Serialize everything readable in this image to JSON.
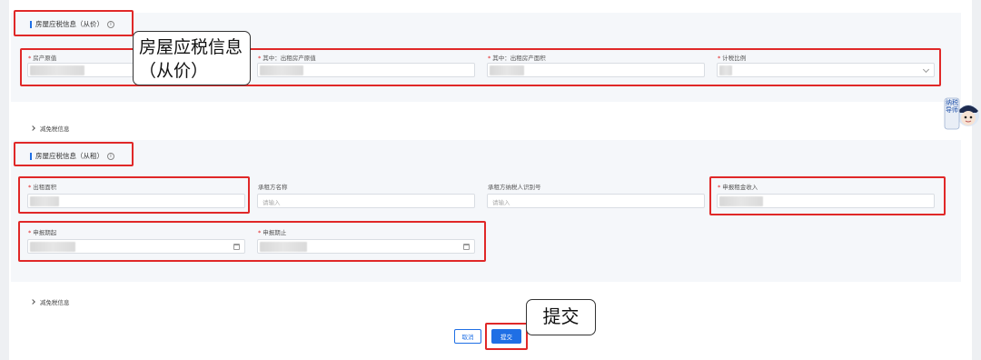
{
  "section_from_value": {
    "title": "房屋应税信息（从价）",
    "info_glyph": "i",
    "callout": "房屋应税信息（从价）",
    "fields": {
      "original_value_label": "房产原值",
      "rented_original_value_label": "其中：出租房产原值",
      "rented_area_label": "其中：出租房产面积",
      "tax_ratio_label": "计税比例"
    },
    "collapse_label": "减免税信息"
  },
  "section_from_rent": {
    "title": "房屋应税信息（从租）",
    "info_glyph": "i",
    "fields": {
      "rental_area_label": "出租面积",
      "lessee_name_label": "承租方名称",
      "lessee_name_placeholder": "请输入",
      "lessee_taxid_label": "承租方纳税人识别号",
      "lessee_taxid_placeholder": "请输入",
      "rent_income_label": "申报租金收入",
      "period_start_label": "申报期起",
      "period_end_label": "申报期止"
    },
    "collapse_label": "减免税信息"
  },
  "required_mark": "*",
  "footer": {
    "cancel_label": "取消",
    "submit_label": "提交",
    "submit_callout": "提交"
  },
  "mascot": {
    "text": "纳税导师",
    "icon": "tax-assistant-mascot-icon"
  },
  "colors": {
    "accent": "#1f6fe5",
    "highlight": "#e02828"
  }
}
